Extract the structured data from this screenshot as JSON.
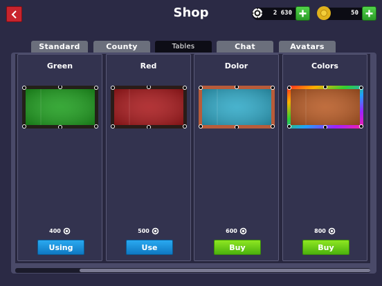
{
  "header": {
    "title": "Shop",
    "back_icon": "chevron-left-icon"
  },
  "currencies": [
    {
      "icon": "pool-chip-icon",
      "value": "2 630"
    },
    {
      "icon": "gold-coin-icon",
      "value": "50"
    }
  ],
  "tabs": [
    {
      "label": "Standard",
      "active": false
    },
    {
      "label": "County",
      "active": false
    },
    {
      "label": "Tables",
      "active": true
    },
    {
      "label": "Chat",
      "active": false
    },
    {
      "label": "Avatars",
      "active": false
    }
  ],
  "items": [
    {
      "name": "Green",
      "felt": "#1e9d1e",
      "rail": "#232018",
      "price": "400",
      "action": "Using",
      "style": "blue"
    },
    {
      "name": "Red",
      "felt": "#a8191c",
      "rail": "#2a1c18",
      "price": "500",
      "action": "Use",
      "style": "blue"
    },
    {
      "name": "Dolor",
      "felt": "#2fa8c6",
      "rail": "#b85c3a",
      "price": "600",
      "action": "Buy",
      "style": "green"
    },
    {
      "name": "Colors",
      "felt": "#b75a24",
      "rail": "rainbow",
      "price": "800",
      "action": "Buy",
      "style": "green"
    }
  ],
  "colors": {
    "bg": "#2b2a45",
    "accent_red": "#c8242d",
    "accent_green": "#4bb10e",
    "accent_blue": "#1a8fe0"
  }
}
